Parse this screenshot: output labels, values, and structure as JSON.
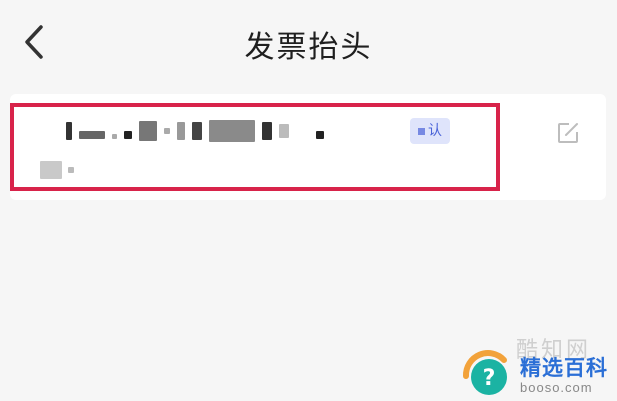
{
  "header": {
    "title": "发票抬头",
    "back_icon": "chevron-left-icon"
  },
  "invoice_list": {
    "items": [
      {
        "name_redacted": true,
        "default_tag": "认",
        "edit_icon": "edit-icon"
      }
    ]
  },
  "watermark": {
    "brand_text": "精选百科",
    "url": "booso.com",
    "ghost_text": "酷知网"
  },
  "colors": {
    "highlight": "#d8234a",
    "tag_bg": "#dfe4fb",
    "tag_text": "#4a63d8",
    "background": "#f6f6f6"
  }
}
